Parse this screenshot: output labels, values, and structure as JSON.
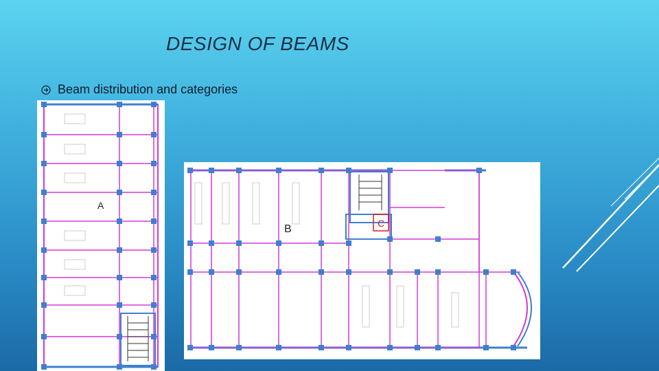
{
  "slide": {
    "title": "DESIGN OF BEAMS",
    "bullets": [
      {
        "icon": "circled-arrow-icon",
        "text": "Beam distribution and categories"
      }
    ]
  },
  "plans": {
    "left": {
      "label": "A"
    },
    "right": {
      "label_b": "B",
      "label_c": "C"
    }
  },
  "colors": {
    "beam": "#d23ad6",
    "column": "#3f7fcf",
    "dim": "#9a9a9a",
    "title": "#1a2f45"
  }
}
